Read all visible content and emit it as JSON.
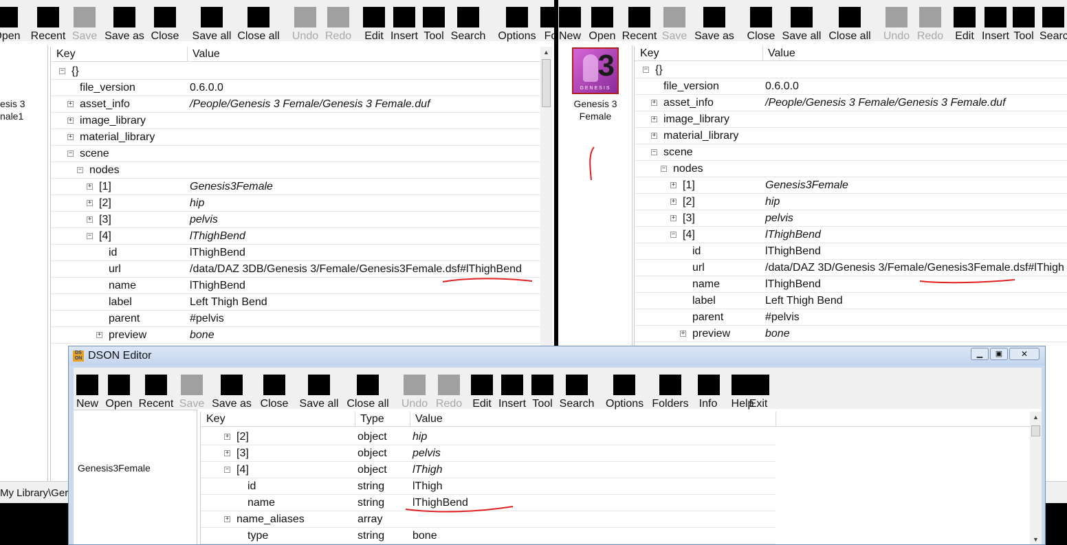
{
  "left": {
    "toolbar": [
      {
        "label": "Open",
        "disabled": false
      },
      {
        "label": "Recent",
        "disabled": false
      },
      {
        "label": "Save",
        "disabled": true
      },
      {
        "label": "Save as",
        "disabled": false
      },
      {
        "label": "Close",
        "disabled": false
      },
      {
        "label": "Save all",
        "disabled": false
      },
      {
        "label": "Close all",
        "disabled": false
      },
      {
        "label": "Undo",
        "disabled": true
      },
      {
        "label": "Redo",
        "disabled": true
      },
      {
        "label": "Edit",
        "disabled": false
      },
      {
        "label": "Insert",
        "disabled": false
      },
      {
        "label": "Tool",
        "disabled": false
      },
      {
        "label": "Search",
        "disabled": false
      },
      {
        "label": "Options",
        "disabled": false
      },
      {
        "label": "Fo",
        "disabled": false
      }
    ],
    "side_label": [
      "esis 3",
      "nale1"
    ],
    "path": "My Library\\Ger",
    "headers": {
      "key": "Key",
      "value": "Value"
    },
    "rows": [
      {
        "key": "{}",
        "value": "",
        "expander": "minus",
        "italic": false
      },
      {
        "key": "file_version",
        "value": "0.6.0.0",
        "expander": "",
        "italic": false
      },
      {
        "key": "asset_info",
        "value": "/People/Genesis 3 Female/Genesis 3 Female.duf",
        "expander": "plus",
        "italic": true
      },
      {
        "key": "image_library",
        "value": "",
        "expander": "plus",
        "italic": false
      },
      {
        "key": "material_library",
        "value": "",
        "expander": "plus",
        "italic": false
      },
      {
        "key": "scene",
        "value": "",
        "expander": "minus",
        "italic": false
      },
      {
        "key": "nodes",
        "value": "",
        "expander": "minus",
        "italic": false
      },
      {
        "key": "[1]",
        "value": "Genesis3Female",
        "expander": "plus",
        "italic": true
      },
      {
        "key": "[2]",
        "value": "hip",
        "expander": "plus",
        "italic": true
      },
      {
        "key": "[3]",
        "value": "pelvis",
        "expander": "plus",
        "italic": true
      },
      {
        "key": "[4]",
        "value": "lThighBend",
        "expander": "minus",
        "italic": true
      },
      {
        "key": "id",
        "value": "lThighBend",
        "expander": "",
        "italic": false
      },
      {
        "key": "url",
        "value": "/data/DAZ 3DB/Genesis 3/Female/Genesis3Female.dsf#lThighBend",
        "expander": "",
        "italic": false
      },
      {
        "key": "name",
        "value": "lThighBend",
        "expander": "",
        "italic": false
      },
      {
        "key": "label",
        "value": "Left Thigh Bend",
        "expander": "",
        "italic": false
      },
      {
        "key": "parent",
        "value": "#pelvis",
        "expander": "",
        "italic": false
      },
      {
        "key": "preview",
        "value": "bone",
        "expander": "plus",
        "italic": true
      }
    ]
  },
  "right": {
    "toolbar": [
      {
        "label": "New",
        "disabled": false
      },
      {
        "label": "Open",
        "disabled": false
      },
      {
        "label": "Recent",
        "disabled": false
      },
      {
        "label": "Save",
        "disabled": true
      },
      {
        "label": "Save as",
        "disabled": false
      },
      {
        "label": "Close",
        "disabled": false
      },
      {
        "label": "Save all",
        "disabled": false
      },
      {
        "label": "Close all",
        "disabled": false
      },
      {
        "label": "Undo",
        "disabled": true
      },
      {
        "label": "Redo",
        "disabled": true
      },
      {
        "label": "Edit",
        "disabled": false
      },
      {
        "label": "Insert",
        "disabled": false
      },
      {
        "label": "Tool",
        "disabled": false
      },
      {
        "label": "Searc",
        "disabled": false
      }
    ],
    "thumb_caption": "Genesis 3 Female",
    "thumb_text": "GENESIS",
    "headers": {
      "key": "Key",
      "value": "Value"
    },
    "rows": [
      {
        "key": "{}",
        "value": "",
        "expander": "minus",
        "italic": false
      },
      {
        "key": "file_version",
        "value": "0.6.0.0",
        "expander": "",
        "italic": false
      },
      {
        "key": "asset_info",
        "value": "/People/Genesis 3 Female/Genesis 3 Female.duf",
        "expander": "plus",
        "italic": true
      },
      {
        "key": "image_library",
        "value": "",
        "expander": "plus",
        "italic": false
      },
      {
        "key": "material_library",
        "value": "",
        "expander": "plus",
        "italic": false
      },
      {
        "key": "scene",
        "value": "",
        "expander": "minus",
        "italic": false
      },
      {
        "key": "nodes",
        "value": "",
        "expander": "minus",
        "italic": false
      },
      {
        "key": "[1]",
        "value": "Genesis3Female",
        "expander": "plus",
        "italic": true
      },
      {
        "key": "[2]",
        "value": "hip",
        "expander": "plus",
        "italic": true
      },
      {
        "key": "[3]",
        "value": "pelvis",
        "expander": "plus",
        "italic": true
      },
      {
        "key": "[4]",
        "value": "lThighBend",
        "expander": "minus",
        "italic": true
      },
      {
        "key": "id",
        "value": "lThighBend",
        "expander": "",
        "italic": false
      },
      {
        "key": "url",
        "value": "/data/DAZ 3D/Genesis 3/Female/Genesis3Female.dsf#lThigh",
        "expander": "",
        "italic": false
      },
      {
        "key": "name",
        "value": "lThighBend",
        "expander": "",
        "italic": false
      },
      {
        "key": "label",
        "value": "Left Thigh Bend",
        "expander": "",
        "italic": false
      },
      {
        "key": "parent",
        "value": "#pelvis",
        "expander": "",
        "italic": false
      },
      {
        "key": "preview",
        "value": "bone",
        "expander": "plus",
        "italic": true
      }
    ]
  },
  "dialog": {
    "title": "DSON Editor",
    "app_icon": "DS ON",
    "toolbar": [
      {
        "label": "New",
        "disabled": false
      },
      {
        "label": "Open",
        "disabled": false
      },
      {
        "label": "Recent",
        "disabled": false
      },
      {
        "label": "Save",
        "disabled": true
      },
      {
        "label": "Save as",
        "disabled": false
      },
      {
        "label": "Close",
        "disabled": false
      },
      {
        "label": "Save all",
        "disabled": false
      },
      {
        "label": "Close all",
        "disabled": false
      },
      {
        "label": "Undo",
        "disabled": true
      },
      {
        "label": "Redo",
        "disabled": true
      },
      {
        "label": "Edit",
        "disabled": false
      },
      {
        "label": "Insert",
        "disabled": false
      },
      {
        "label": "Tool",
        "disabled": false
      },
      {
        "label": "Search",
        "disabled": false
      },
      {
        "label": "Options",
        "disabled": false
      },
      {
        "label": "Folders",
        "disabled": false
      },
      {
        "label": "Info",
        "disabled": false
      },
      {
        "label": "Help",
        "disabled": false
      },
      {
        "label": "Exit",
        "disabled": false
      }
    ],
    "side_label": "Genesis3Female",
    "headers": {
      "key": "Key",
      "type": "Type",
      "value": "Value"
    },
    "rows": [
      {
        "key": "[2]",
        "type": "object",
        "value": "hip",
        "expander": "plus",
        "italic": true
      },
      {
        "key": "[3]",
        "type": "object",
        "value": "pelvis",
        "expander": "plus",
        "italic": true
      },
      {
        "key": "[4]",
        "type": "object",
        "value": "lThigh",
        "expander": "minus",
        "italic": true
      },
      {
        "key": "id",
        "type": "string",
        "value": "lThigh",
        "expander": "",
        "italic": false
      },
      {
        "key": "name",
        "type": "string",
        "value": "lThighBend",
        "expander": "",
        "italic": false
      },
      {
        "key": "name_aliases",
        "type": "array",
        "value": "",
        "expander": "plus",
        "italic": false
      },
      {
        "key": "type",
        "type": "string",
        "value": "bone",
        "expander": "",
        "italic": false
      }
    ]
  },
  "colors": {
    "annotation": "#e02020",
    "toolbar_bg": "#f0f0f0",
    "titlebar": "#c9daef"
  }
}
